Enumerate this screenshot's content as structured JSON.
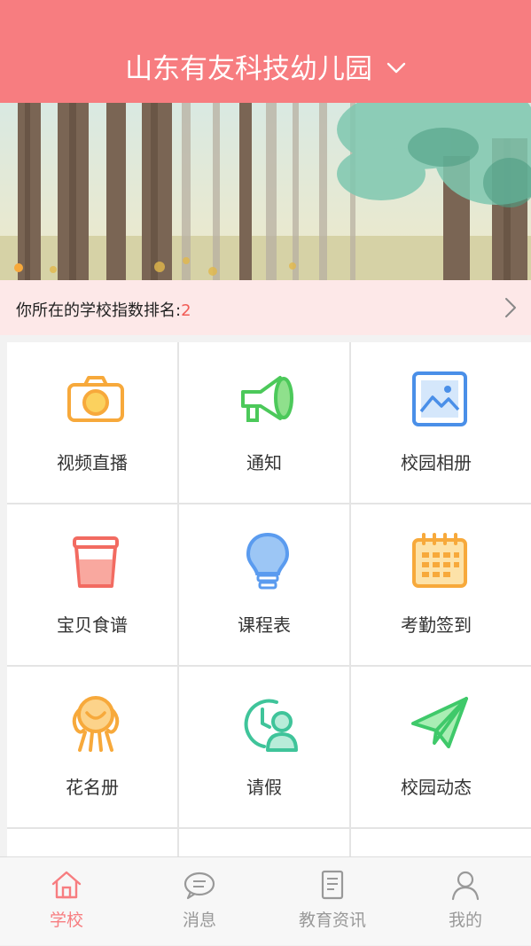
{
  "header": {
    "title": "山东有友科技幼儿园"
  },
  "rank": {
    "label": "你所在的学校指数排名:",
    "value": "2"
  },
  "grid": [
    {
      "label": "视频直播",
      "icon": "camera-icon",
      "color": "#f7a93b"
    },
    {
      "label": "通知",
      "icon": "megaphone-icon",
      "color": "#4cc95a"
    },
    {
      "label": "校园相册",
      "icon": "photo-album-icon",
      "color": "#4a8fe8"
    },
    {
      "label": "宝贝食谱",
      "icon": "cup-icon",
      "color": "#f26b61"
    },
    {
      "label": "课程表",
      "icon": "lightbulb-icon",
      "color": "#5a9bef"
    },
    {
      "label": "考勤签到",
      "icon": "calendar-icon",
      "color": "#f7a93b"
    },
    {
      "label": "花名册",
      "icon": "roster-icon",
      "color": "#f7a93b"
    },
    {
      "label": "请假",
      "icon": "leave-request-icon",
      "color": "#3fc49a"
    },
    {
      "label": "校园动态",
      "icon": "paper-plane-icon",
      "color": "#3fc96a"
    }
  ],
  "tabs": [
    {
      "label": "学校",
      "icon": "home-icon",
      "active": true
    },
    {
      "label": "消息",
      "icon": "chat-bubble-icon",
      "active": false
    },
    {
      "label": "教育资讯",
      "icon": "document-icon",
      "active": false
    },
    {
      "label": "我的",
      "icon": "user-icon",
      "active": false
    }
  ],
  "colors": {
    "primary": "#f77d80",
    "rank_bg": "#fde8e8",
    "rank_value": "#f15b55"
  }
}
